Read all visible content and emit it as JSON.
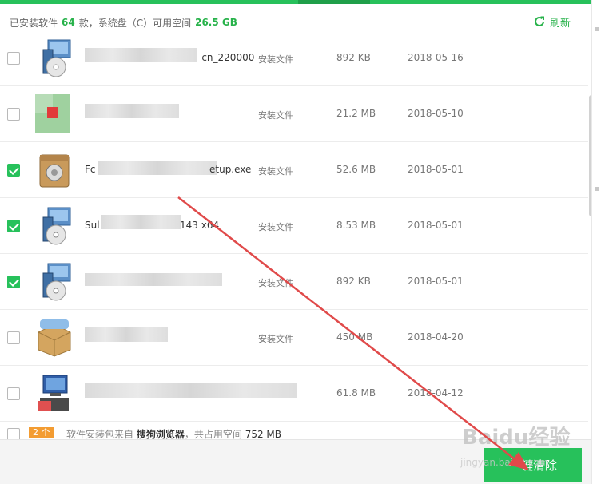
{
  "summary": {
    "prefix": "已安装软件",
    "count": "64",
    "middle": "款，系统盘（C）可用空间",
    "free_space": "26.5 GB"
  },
  "refresh_label": "刷新",
  "files": [
    {
      "name_visible": "-cn_220000",
      "type": "安装文件",
      "size": "892 KB",
      "date": "2018-05-16",
      "checked": false,
      "icon": "installer-cd-icon"
    },
    {
      "name_visible": "",
      "type": "安装文件",
      "size": "21.2 MB",
      "date": "2018-05-10",
      "checked": false,
      "icon": "app-icon"
    },
    {
      "name_visible_start": "Fc",
      "name_visible_end": "etup.exe",
      "type": "安装文件",
      "size": "52.6 MB",
      "date": "2018-05-01",
      "checked": true,
      "icon": "package-box-icon"
    },
    {
      "name_visible_start": "Sul",
      "name_visible_end": "143 x64",
      "type": "安装文件",
      "size": "8.53 MB",
      "date": "2018-05-01",
      "checked": true,
      "icon": "installer-cd-icon"
    },
    {
      "name_visible": "",
      "type": "安装文件",
      "size": "892 KB",
      "date": "2018-05-01",
      "checked": true,
      "icon": "installer-cd-icon"
    },
    {
      "name_visible": "",
      "type": "安装文件",
      "size": "450 MB",
      "date": "2018-04-20",
      "checked": false,
      "icon": "package-box-icon"
    },
    {
      "name_visible": "",
      "type": "安装文件",
      "size": "61.8 MB",
      "date": "2018-04-12",
      "checked": false,
      "icon": "setup-computer-icon"
    }
  ],
  "group": {
    "badge": "2 个",
    "text_prefix": "软件安装包来自",
    "source": "搜狗浏览器",
    "text_suffix": "，共占用空间",
    "total": "752 MB"
  },
  "clean_button": "一键清除",
  "watermark": {
    "logo": "Baidu经验",
    "url": "jingyan.baidu.com"
  },
  "colors": {
    "accent": "#27c15b",
    "badge": "#f39c32",
    "arrow": "#e04a4a"
  }
}
